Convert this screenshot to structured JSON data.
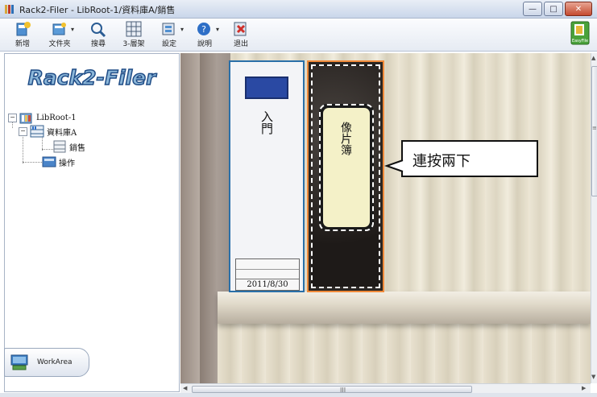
{
  "window": {
    "title": "Rack2-Filer - LibRoot-1/資料庫A/銷售",
    "minimize": "—",
    "maximize": "□",
    "close": "✕"
  },
  "toolbar": {
    "new_label": "新增",
    "folder_label": "文件夾",
    "search_label": "搜尋",
    "layer_label": "3-層架",
    "settings_label": "設定",
    "help_label": "說明",
    "exit_label": "退出",
    "easyfile_label": "EasyFile"
  },
  "sidebar": {
    "logo": "Rack2-Filer",
    "tree": [
      {
        "label": "LibRoot-1",
        "toggle": "−"
      },
      {
        "label": "資料庫A",
        "toggle": "−"
      },
      {
        "label": "銷售"
      },
      {
        "label": "操作"
      }
    ],
    "workarea_label": "WorkArea"
  },
  "shelf": {
    "binder1": {
      "title": "入門",
      "date": "2011/8/30"
    },
    "binder2": {
      "title": "像片簿"
    },
    "callout": "連按兩下"
  },
  "scroll": {
    "hgrip": "III",
    "vgrip": "≡"
  },
  "colors": {
    "accent_blue": "#2a6fa8",
    "selected_orange": "#f08a3a"
  }
}
